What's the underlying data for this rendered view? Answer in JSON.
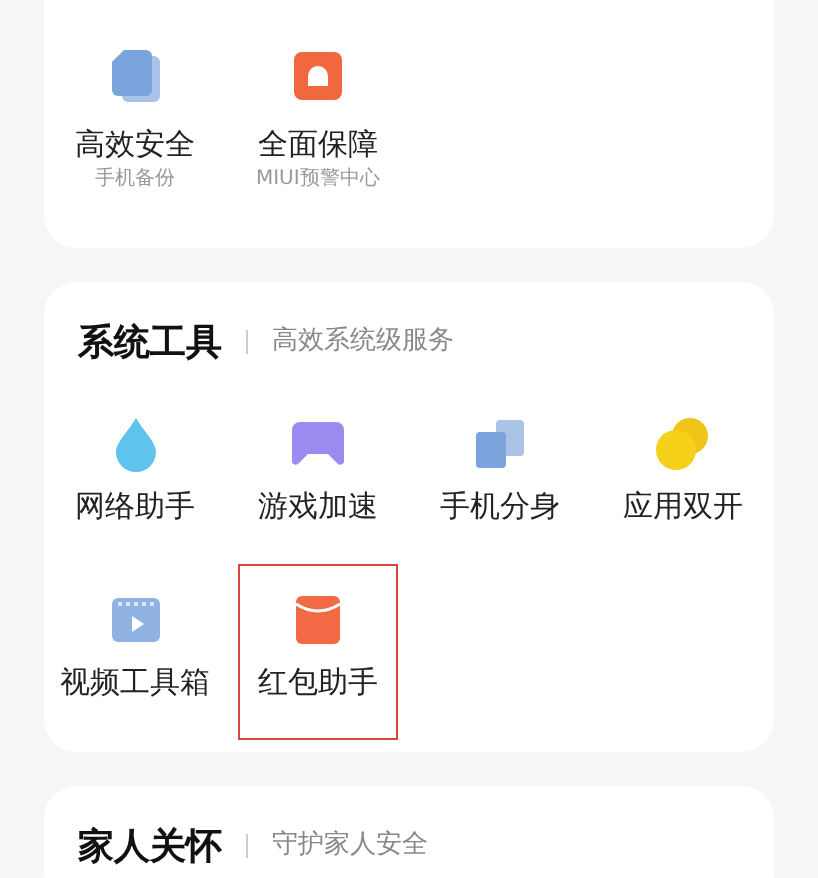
{
  "sections": [
    {
      "items": [
        {
          "label": "高效安全",
          "sublabel": "手机备份",
          "highlighted": false
        },
        {
          "label": "全面保障",
          "sublabel": "MIUI预警中心",
          "highlighted": false
        }
      ]
    },
    {
      "title": "系统工具",
      "subtitle": "高效系统级服务",
      "items": [
        {
          "label": "网络助手",
          "highlighted": false
        },
        {
          "label": "游戏加速",
          "highlighted": false
        },
        {
          "label": "手机分身",
          "highlighted": false
        },
        {
          "label": "应用双开",
          "highlighted": false
        },
        {
          "label": "视频工具箱",
          "highlighted": false
        },
        {
          "label": "红包助手",
          "highlighted": true
        }
      ]
    },
    {
      "title": "家人关怀",
      "subtitle": "守护家人安全"
    }
  ]
}
